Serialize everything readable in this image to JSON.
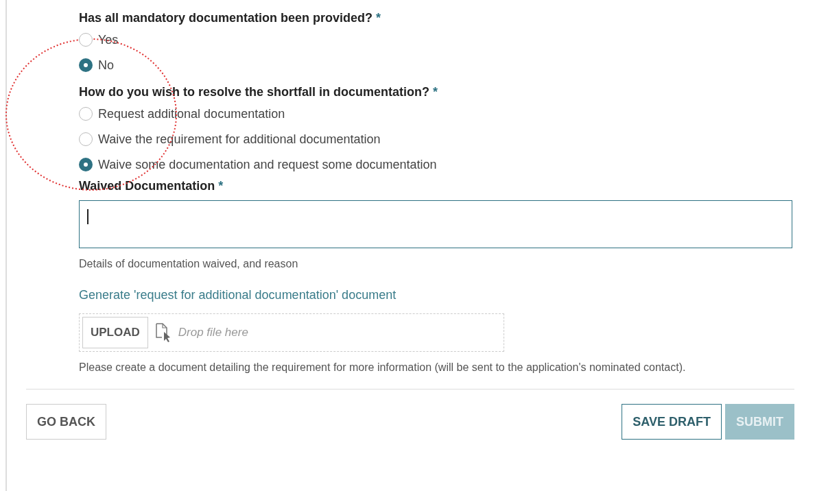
{
  "questions": [
    {
      "label": "Has all mandatory documentation been provided?",
      "required_mark": "*",
      "options": [
        {
          "label": "Yes",
          "selected": false
        },
        {
          "label": "No",
          "selected": true
        }
      ]
    },
    {
      "label": "How do you wish to resolve the shortfall in documentation?",
      "required_mark": "*",
      "options": [
        {
          "label": "Request additional documentation",
          "selected": false
        },
        {
          "label": "Waive the requirement for additional documentation",
          "selected": false
        },
        {
          "label": "Waive some documentation and request some documentation",
          "selected": true
        }
      ]
    }
  ],
  "waived_field": {
    "label": "Waived Documentation",
    "required_mark": "*",
    "hint": "Details of documentation waived, and reason"
  },
  "generate_link": "Generate 'request for additional documentation' document",
  "upload": {
    "button": "UPLOAD",
    "drop_hint": "Drop file here",
    "note": "Please create a document detailing the requirement for more information (will be sent to the application's nominated contact)."
  },
  "buttons": [
    {
      "label": "GO BACK",
      "kind": "secondary"
    },
    {
      "label": "SAVE DRAFT",
      "kind": "outline"
    },
    {
      "label": "SUBMIT",
      "kind": "primary",
      "disabled": true
    }
  ]
}
